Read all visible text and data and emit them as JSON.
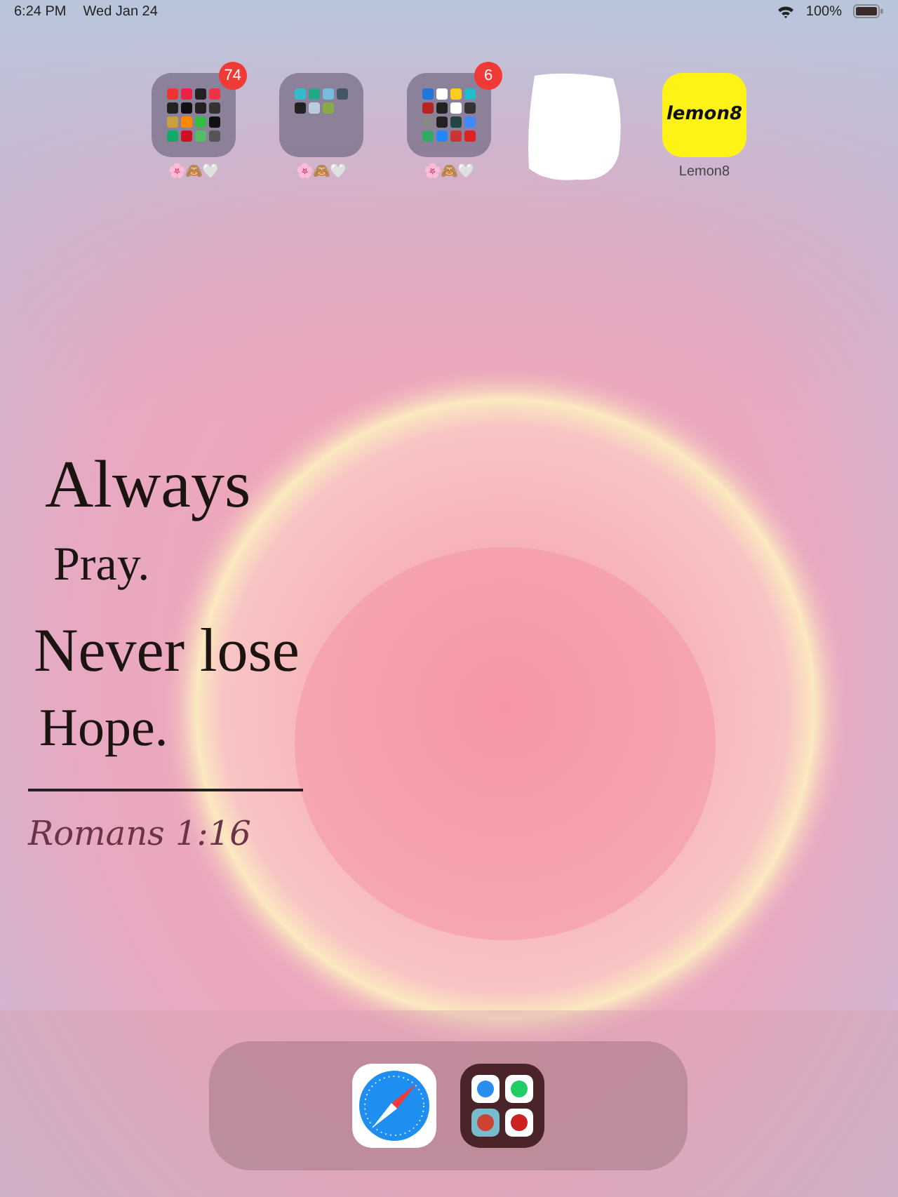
{
  "status_bar": {
    "time": "6:24 PM",
    "date": "Wed Jan 24",
    "battery": "100%"
  },
  "apps": [
    {
      "kind": "folder",
      "label": "🌸🙈🤍",
      "badge": "74"
    },
    {
      "kind": "folder",
      "label": "🌸🙈🤍"
    },
    {
      "kind": "folder",
      "label": "🌸🙈🤍",
      "badge": "6"
    },
    {
      "kind": "redacted"
    },
    {
      "kind": "app",
      "label": "Lemon8",
      "icon_text": "lemon8"
    }
  ],
  "wallpaper": {
    "kind": "picture",
    "quote": [
      "Always",
      "Pray.",
      "Never lose",
      "Hope."
    ],
    "reference": "Romans 1:16"
  },
  "dock": [
    {
      "kind": "app"
    },
    {
      "kind": "folder"
    }
  ]
}
